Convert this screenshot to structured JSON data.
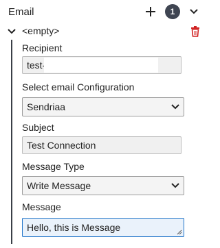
{
  "header": {
    "title": "Email",
    "count": "1",
    "icons": [
      "plus-icon",
      "chevron-down-icon"
    ]
  },
  "item": {
    "title": "<empty>",
    "icons": [
      "chevron-down-icon",
      "trash-icon"
    ],
    "delete_color": "#d02020"
  },
  "fields": {
    "recipient_label": "Recipient",
    "recipient_value": "test-a",
    "config_label": "Select email Configuration",
    "config_value": "Sendriaa",
    "subject_label": "Subject",
    "subject_value": "Test Connection",
    "type_label": "Message Type",
    "type_value": "Write Message",
    "message_label": "Message",
    "message_value": "Hello, this is Message"
  },
  "colors": {
    "badge": "#3f4552",
    "focus": "#1e73c8"
  }
}
